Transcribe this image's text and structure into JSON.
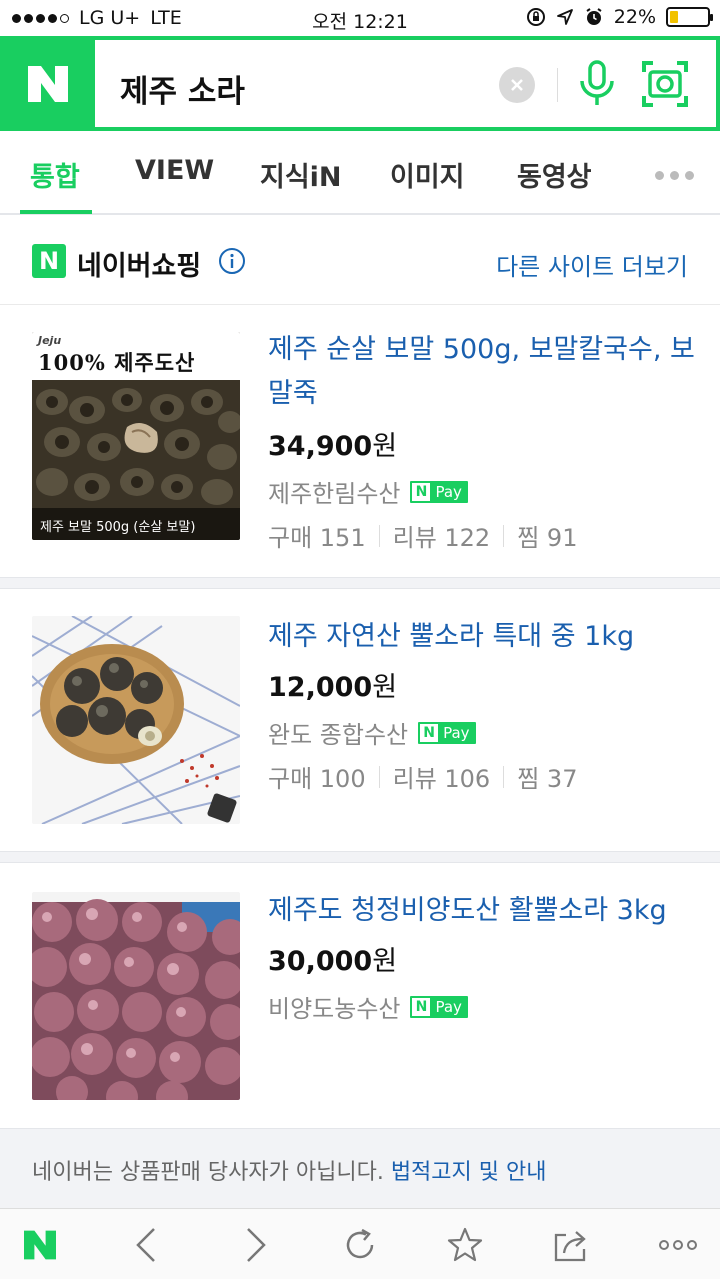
{
  "status_bar": {
    "carrier": "LG U+",
    "network": "LTE",
    "time": "오전 12:21",
    "battery_percent": "22%",
    "battery_level": 0.22,
    "accent": "#f2c200"
  },
  "search": {
    "query": "제주 소라",
    "brand_color": "#19ce60"
  },
  "tabs": [
    {
      "label": "통합",
      "active": true
    },
    {
      "label": "VIEW"
    },
    {
      "label": "지식iN"
    },
    {
      "label": "이미지"
    },
    {
      "label": "동영상"
    }
  ],
  "shopping": {
    "title": "네이버쇼핑",
    "logo_letter": "N",
    "more_sites": "다른 사이트 더보기"
  },
  "products": [
    {
      "title": "제주 순살 보말 500g, 보말칼국수, 보말죽",
      "price": "34,900",
      "currency": "원",
      "seller": "제주한림수산",
      "pay": "Pay",
      "stats": [
        "구매 151",
        "리뷰 122",
        "찜 91"
      ],
      "thumb_banner": "100% 제주도산",
      "thumb_brand": "Jeju",
      "thumb_caption": "제주 보말 500g (순살 보말)"
    },
    {
      "title": "제주 자연산 뿔소라 특대 중 1kg",
      "price": "12,000",
      "currency": "원",
      "seller": "완도 종합수산",
      "pay": "Pay",
      "stats": [
        "구매 100",
        "리뷰 106",
        "찜 37"
      ]
    },
    {
      "title": "제주도 청정비양도산 활뿔소라 3kg",
      "price": "30,000",
      "currency": "원",
      "seller": "비양도농수산",
      "pay": "Pay"
    }
  ],
  "footer": {
    "notice": "네이버는 상품판매 당사자가 아닙니다. ",
    "link": "법적고지 및 안내"
  },
  "toolbar": {
    "icons": [
      "naver-home-icon",
      "back-icon",
      "forward-icon",
      "refresh-icon",
      "bookmark-star-icon",
      "share-icon",
      "more-icon"
    ]
  }
}
